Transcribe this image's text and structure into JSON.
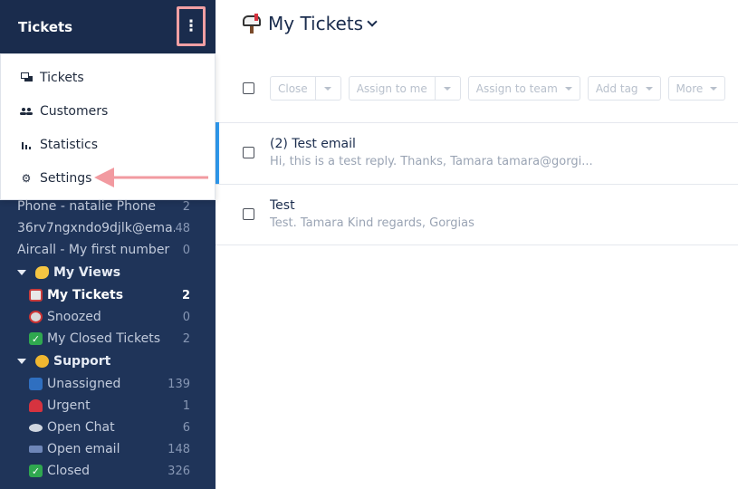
{
  "sidebar": {
    "title": "Tickets",
    "menu": [
      {
        "label": "Tickets",
        "icon": "chat-icon"
      },
      {
        "label": "Customers",
        "icon": "users-icon"
      },
      {
        "label": "Statistics",
        "icon": "bar-chart-icon"
      },
      {
        "label": "Settings",
        "icon": "gear-icon"
      }
    ],
    "channels": [
      {
        "label": "Phone - natalie Phone",
        "count": "2"
      },
      {
        "label": "36rv7ngxndo9djlk@ema...",
        "count": "48"
      },
      {
        "label": "Aircall - My first number",
        "count": "0"
      }
    ],
    "my_views": {
      "label": "My Views",
      "items": [
        {
          "label": "My Tickets",
          "count": "2"
        },
        {
          "label": "Snoozed",
          "count": "0"
        },
        {
          "label": "My Closed Tickets",
          "count": "2"
        }
      ]
    },
    "support": {
      "label": "Support",
      "items": [
        {
          "label": "Unassigned",
          "count": "139"
        },
        {
          "label": "Urgent",
          "count": "1"
        },
        {
          "label": "Open Chat",
          "count": "6"
        },
        {
          "label": "Open email",
          "count": "148"
        },
        {
          "label": "Closed",
          "count": "326"
        }
      ]
    }
  },
  "main": {
    "title": "My Tickets",
    "toolbar": {
      "close": "Close",
      "assign_me": "Assign to me",
      "assign_team": "Assign to team",
      "add_tag": "Add tag",
      "more": "More"
    },
    "tickets": [
      {
        "subject": "(2) Test email",
        "excerpt": "Hi, this is a test reply. Thanks, Tamara tamara@gorgi..."
      },
      {
        "subject": "Test",
        "excerpt": "Test. Tamara Kind regards, Gorgias"
      }
    ]
  },
  "colors": {
    "sidebar_bg": "#1f3459",
    "accent": "#2f9bf0",
    "highlight": "#f2a0a4"
  }
}
